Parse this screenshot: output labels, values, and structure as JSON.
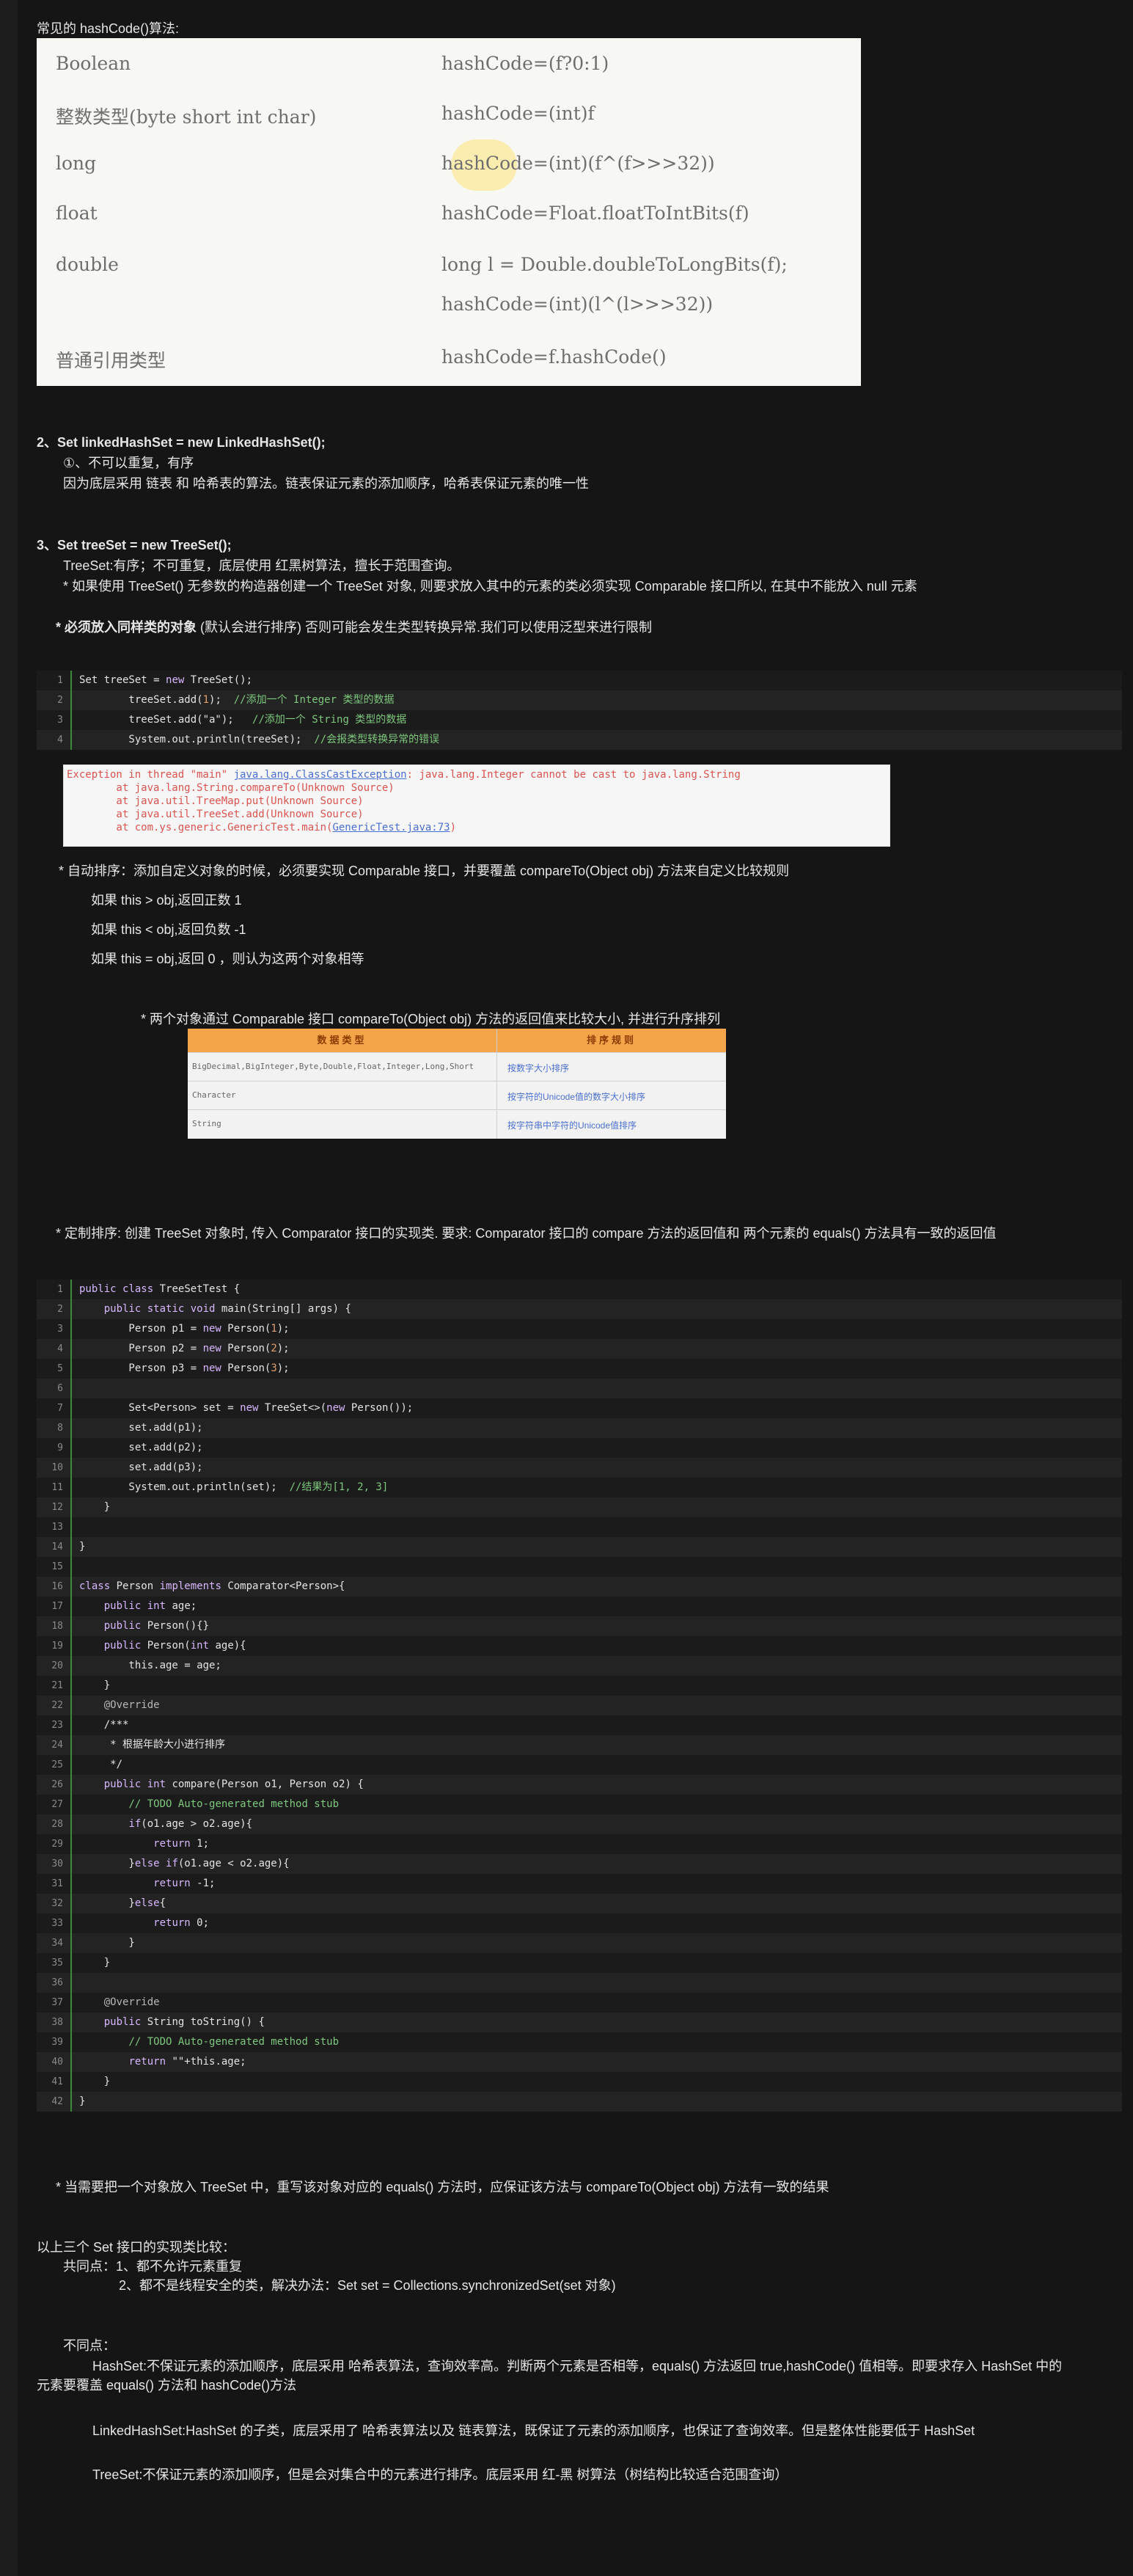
{
  "hashcode": {
    "heading": "常见的 hashCode()算法:",
    "rows": [
      {
        "type": "Boolean",
        "formula": "hashCode=(f?0:1)"
      },
      {
        "type": "整数类型(byte   short   int  char)",
        "formula": "hashCode=(int)f"
      },
      {
        "type": "long",
        "formula": "hashCode=(int)(f^(f>>>32))"
      },
      {
        "type": "float",
        "formula": "hashCode=Float.floatToIntBits(f)"
      },
      {
        "type": "double",
        "formula": "long l = Double.doubleToLongBits(f);"
      },
      {
        "type": "",
        "formula": "hashCode=(int)(l^(l>>>32))"
      },
      {
        "type": "普通引用类型",
        "formula": "hashCode=f.hashCode()"
      }
    ]
  },
  "s2": {
    "title": "2、Set linkedHashSet = new LinkedHashSet();",
    "l1": "①、不可以重复，有序",
    "l2": "因为底层采用 链表 和 哈希表的算法。链表保证元素的添加顺序，哈希表保证元素的唯一性"
  },
  "s3": {
    "title": "3、Set treeSet = new TreeSet();",
    "l1": "TreeSet:有序；不可重复，底层使用 红黑树算法，擅长于范围查询。",
    "l2": "*  如果使用 TreeSet() 无参数的构造器创建一个 TreeSet 对象, 则要求放入其中的元素的类必须实现 Comparable 接口所以, 在其中不能放入 null 元素",
    "l3a": "*  必须放入同样类的对象",
    "l3b": "(默认会进行排序) 否则可能会发生类型转换异常.我们可以使用泛型来进行限制"
  },
  "code1": [
    {
      "n": "1",
      "t": "Set treeSet = new TreeSet();"
    },
    {
      "n": "2",
      "t": "        treeSet.add(1);  ",
      "c": "//添加一个 Integer 类型的数据"
    },
    {
      "n": "3",
      "t": "        treeSet.add(\"a\");   ",
      "c": "//添加一个 String 类型的数据"
    },
    {
      "n": "4",
      "t": "        System.out.println(treeSet);  ",
      "c": "//会报类型转换异常的错误"
    }
  ],
  "exception": {
    "l1a": "Exception in thread \"main\" ",
    "l1link": "java.lang.ClassCastException",
    "l1b": ": java.lang.Integer cannot be cast to java.lang.String",
    "l2": "        at java.lang.String.compareTo(Unknown Source)",
    "l3": "        at java.util.TreeMap.put(Unknown Source)",
    "l4": "        at java.util.TreeSet.add(Unknown Source)",
    "l5a": "        at com.ys.generic.GenericTest.main(",
    "l5link": "GenericTest.java:73",
    "l5b": ")"
  },
  "natural": {
    "intro": "*   自动排序：添加自定义对象的时候，必须要实现 Comparable 接口，并要覆盖 compareTo(Object obj) 方法来自定义比较规则",
    "r1": "如果 this > obj,返回正数 1",
    "r2": "如果 this < obj,返回负数 -1",
    "r3": "如果 this = obj,返回 0 ，则认为这两个对象相等",
    "note": "*  两个对象通过 Comparable 接口 compareTo(Object obj) 方法的返回值来比较大小, 并进行升序排列"
  },
  "sort_table": {
    "h1": "数据类型",
    "h2": "排序规则",
    "rows": [
      {
        "a": "BigDecimal,BigInteger,Byte,Double,Float,Integer,Long,Short",
        "b": "按数字大小排序"
      },
      {
        "a": "Character",
        "b": "按字符的Unicode值的数字大小排序"
      },
      {
        "a": "String",
        "b": "按字符串中字符的Unicode值排序"
      }
    ]
  },
  "custom": {
    "intro": "*  定制排序: 创建 TreeSet 对象时, 传入 Comparator 接口的实现类. 要求: Comparator 接口的 compare 方法的返回值和 两个元素的 equals() 方法具有一致的返回值"
  },
  "code2": [
    {
      "n": "1",
      "t": "public class TreeSetTest {"
    },
    {
      "n": "2",
      "t": "    public static void main(String[] args) {"
    },
    {
      "n": "3",
      "t": "        Person p1 = new Person(1);"
    },
    {
      "n": "4",
      "t": "        Person p2 = new Person(2);"
    },
    {
      "n": "5",
      "t": "        Person p3 = new Person(3);"
    },
    {
      "n": "6",
      "t": ""
    },
    {
      "n": "7",
      "t": "        Set<Person> set = new TreeSet<>(new Person());"
    },
    {
      "n": "8",
      "t": "        set.add(p1);"
    },
    {
      "n": "9",
      "t": "        set.add(p2);"
    },
    {
      "n": "10",
      "t": "        set.add(p3);"
    },
    {
      "n": "11",
      "t": "        System.out.println(set);  ",
      "c": "//结果为[1, 2, 3]"
    },
    {
      "n": "12",
      "t": "    }"
    },
    {
      "n": "13",
      "t": ""
    },
    {
      "n": "14",
      "t": "}"
    },
    {
      "n": "15",
      "t": ""
    },
    {
      "n": "16",
      "t": "class Person implements Comparator<Person>{"
    },
    {
      "n": "17",
      "t": "    public int age;"
    },
    {
      "n": "18",
      "t": "    public Person(){}"
    },
    {
      "n": "19",
      "t": "    public Person(int age){"
    },
    {
      "n": "20",
      "t": "        this.age = age;"
    },
    {
      "n": "21",
      "t": "    }"
    },
    {
      "n": "22",
      "t": "    @Override"
    },
    {
      "n": "23",
      "t": "    /***"
    },
    {
      "n": "24",
      "t": "     * 根据年龄大小进行排序"
    },
    {
      "n": "25",
      "t": "     */"
    },
    {
      "n": "26",
      "t": "    public int compare(Person o1, Person o2) {"
    },
    {
      "n": "27",
      "t": "        ",
      "c": "// TODO Auto-generated method stub"
    },
    {
      "n": "28",
      "t": "        if(o1.age > o2.age){"
    },
    {
      "n": "29",
      "t": "            return 1;"
    },
    {
      "n": "30",
      "t": "        }else if(o1.age < o2.age){"
    },
    {
      "n": "31",
      "t": "            return -1;"
    },
    {
      "n": "32",
      "t": "        }else{"
    },
    {
      "n": "33",
      "t": "            return 0;"
    },
    {
      "n": "34",
      "t": "        }"
    },
    {
      "n": "35",
      "t": "    }"
    },
    {
      "n": "36",
      "t": ""
    },
    {
      "n": "37",
      "t": "    @Override"
    },
    {
      "n": "38",
      "t": "    public String toString() {"
    },
    {
      "n": "39",
      "t": "        ",
      "c": "// TODO Auto-generated method stub"
    },
    {
      "n": "40",
      "t": "        return \"\"+this.age;"
    },
    {
      "n": "41",
      "t": "    }"
    },
    {
      "n": "42",
      "t": "}"
    }
  ],
  "equals_note": "*  当需要把一个对象放入 TreeSet 中，重写该对象对应的 equals() 方法时，应保证该方法与 compareTo(Object obj) 方法有一致的结果",
  "compare": {
    "title": "以上三个 Set 接口的实现类比较：",
    "same_label": "共同点：1、都不允许元素重复",
    "same2": "2、都不是线程安全的类，解决办法：Set set = Collections.synchronizedSet(set 对象)",
    "diff_label": "不同点：",
    "hash1": "HashSet:不保证元素的添加顺序，底层采用 哈希表算法，查询效率高。判断两个元素是否相等，equals() 方法返回 true,hashCode() 值相等。即要求存入 HashSet 中的",
    "hash2": "元素要覆盖 equals() 方法和 hashCode()方法",
    "linked": "LinkedHashSet:HashSet 的子类，底层采用了 哈希表算法以及 链表算法，既保证了元素的添加顺序，也保证了查询效率。但是整体性能要低于 HashSet",
    "tree": "TreeSet:不保证元素的添加顺序，但是会对集合中的元素进行排序。底层采用 红-黑 树算法（树结构比较适合范围查询）"
  }
}
